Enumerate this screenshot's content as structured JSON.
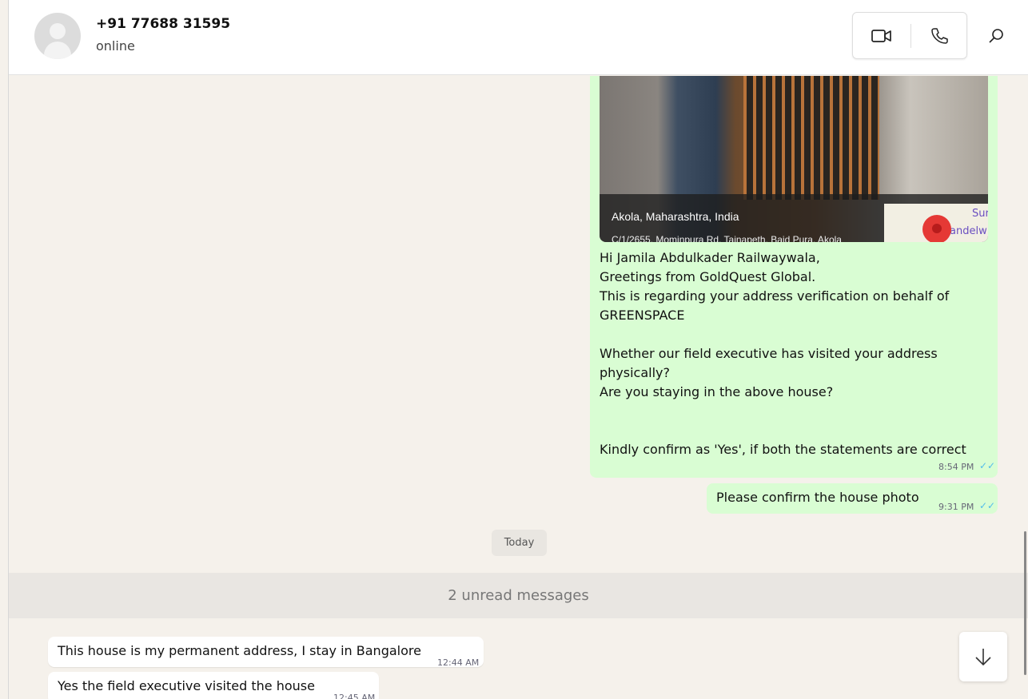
{
  "header": {
    "contact_name": "+91 77688 31595",
    "status": "online"
  },
  "photo_message": {
    "location_title": "Akola, Maharashtra, India",
    "location_address": "C/1/2655, Mominpura Rd, Tajnapeth, Baid Pura, Akola",
    "map_label_1": "Sur",
    "map_label_2": "andelw"
  },
  "messages": [
    {
      "direction": "outgoing",
      "lines": [
        "Hi Jamila Abdulkader Railwaywala,",
        "Greetings from GoldQuest Global.",
        "This is regarding your address verification on behalf of",
        "GREENSPACE",
        "",
        "Whether our field executive has visited your address",
        "physically?",
        "Are you staying in the above house?",
        "",
        "",
        "Kindly confirm as 'Yes', if both the statements are correct"
      ],
      "time": "8:54 PM",
      "ticks": "✓✓"
    },
    {
      "direction": "outgoing",
      "text": "Please confirm the house photo",
      "time": "9:31 PM",
      "ticks": "✓✓"
    },
    {
      "direction": "incoming",
      "text": "This house is my permanent address, I stay in Bangalore",
      "time": "12:44 AM"
    },
    {
      "direction": "incoming",
      "text": "Yes the field executive visited the house",
      "time": "12:45 AM"
    }
  ],
  "date_divider": "Today",
  "unread_banner": "2 unread messages"
}
